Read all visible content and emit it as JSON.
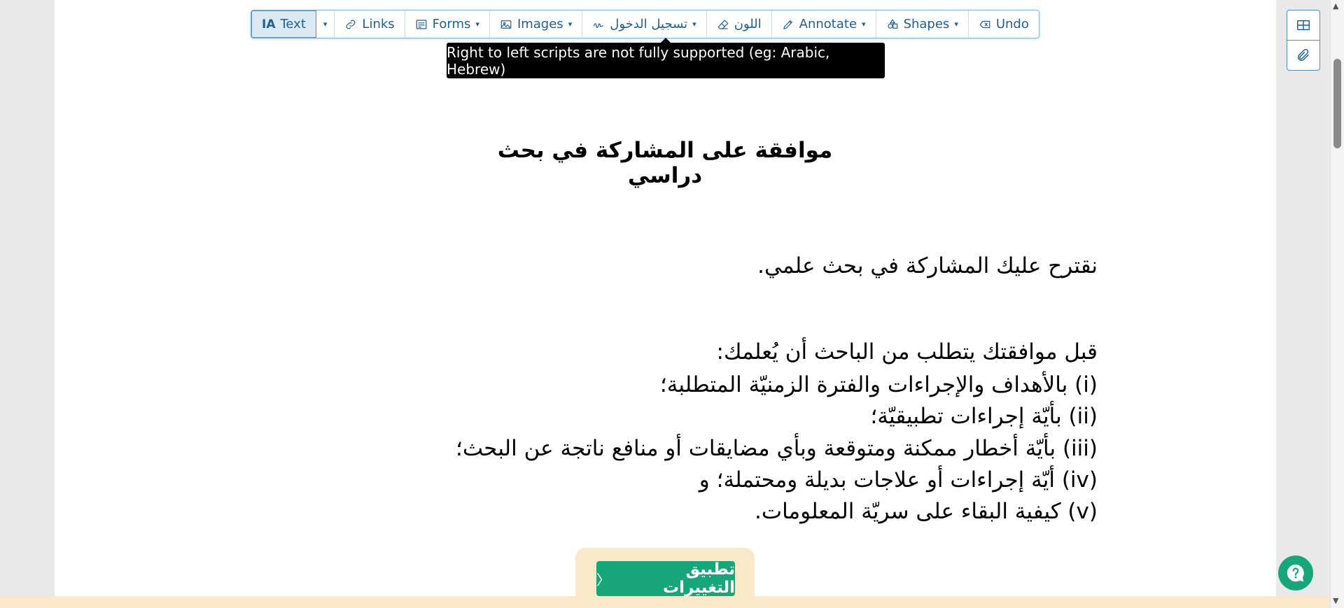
{
  "toolbar": {
    "text_label": "Text",
    "links_label": "Links",
    "forms_label": "Forms",
    "images_label": "Images",
    "sign_label": "تسجيل الدخول",
    "color_label": "اللون",
    "annotate_label": "Annotate",
    "shapes_label": "Shapes",
    "undo_label": "Undo",
    "caret": "▾"
  },
  "tooltip": {
    "text": "Right to left scripts are not fully supported (eg: Arabic, Hebrew)"
  },
  "document": {
    "title": "موافقة على المشاركة في بحث دراسي",
    "intro": "نقترح عليك المشاركة في بحث علمي.",
    "lead": "قبل موافقتك يتطلب من الباحث أن يُعلمك:",
    "items": [
      "(i) بالأهداف والإجراءات والفترة الزمنيّة المتطلبة؛",
      "(ii) بأيّة إجراءات تطبيقيّة؛",
      "(iii) بأيّة أخطار ممكنة ومتوقعة وبأي مضايقات أو منافع ناتجة عن البحث؛",
      "(iv) أيّة إجراءات أو علاجات بديلة ومحتملة؛ و",
      "(v) كيفية البقاء على سريّة المعلومات."
    ]
  },
  "apply": {
    "label": "تطبيق التغييرات",
    "chevron": "〈"
  },
  "scrollbar": {
    "up": "▲",
    "down": "▼"
  },
  "colors": {
    "accent": "#1f5f91",
    "apply_green": "#17a67a",
    "banner_cream": "#fbe7c9"
  }
}
